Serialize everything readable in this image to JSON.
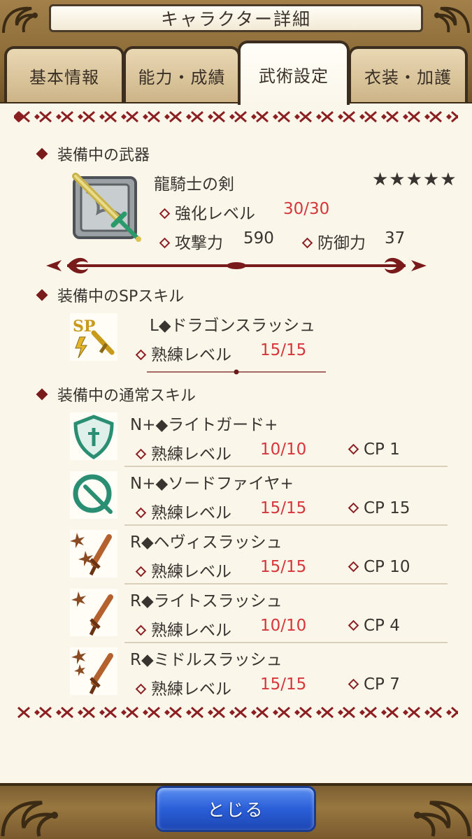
{
  "header": {
    "title": "キャラクター詳細"
  },
  "tabs": [
    {
      "label": "基本情報"
    },
    {
      "label": "能力・成績"
    },
    {
      "label": "武術設定"
    },
    {
      "label": "衣装・加護"
    }
  ],
  "weapon_section": {
    "heading": "装備中の武器",
    "name": "龍騎士の剣",
    "rarity": "★★★★★",
    "level_label": "強化レベル",
    "level_value": "30/30",
    "attack_label": "攻撃力",
    "attack_value": "590",
    "defense_label": "防御力",
    "defense_value": "37"
  },
  "sp_section": {
    "heading": "装備中のSPスキル",
    "skill_name": "L◆ドラゴンスラッシュ",
    "prof_label": "熟練レベル",
    "prof_value": "15/15"
  },
  "normal_section": {
    "heading": "装備中の通常スキル",
    "skills": [
      {
        "name": "N+◆ライトガード+",
        "prof_label": "熟練レベル",
        "prof_value": "10/10",
        "cp": "CP 1",
        "icon": "shield-icon"
      },
      {
        "name": "N+◆ソードファイヤ+",
        "prof_label": "熟練レベル",
        "prof_value": "15/15",
        "cp": "CP 15",
        "icon": "sword-ring-icon"
      },
      {
        "name": "R◆ヘヴィスラッシュ",
        "prof_label": "熟練レベル",
        "prof_value": "15/15",
        "cp": "CP 10",
        "icon": "heavy-slash-icon"
      },
      {
        "name": "R◆ライトスラッシュ",
        "prof_label": "熟練レベル",
        "prof_value": "10/10",
        "cp": "CP 4",
        "icon": "light-slash-icon"
      },
      {
        "name": "R◆ミドルスラッシュ",
        "prof_label": "熟練レベル",
        "prof_value": "15/15",
        "cp": "CP 7",
        "icon": "middle-slash-icon"
      }
    ]
  },
  "footer": {
    "close_label": "とじる"
  },
  "colors": {
    "accent_red": "#d6363a",
    "frame_gold": "#98773f",
    "button_blue": "#2a5ed8"
  }
}
